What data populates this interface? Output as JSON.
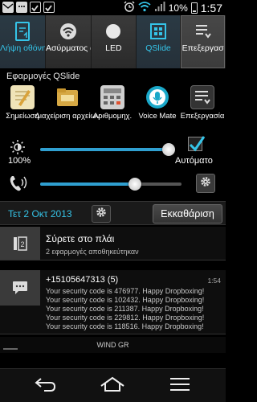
{
  "status_bar": {
    "battery_percent": "10%",
    "time": "1:57",
    "icons": [
      "email-icon",
      "sms-icon",
      "checkbox-icon",
      "checkbox-icon",
      "alarm-icon",
      "wifi-icon",
      "signal-icon",
      "battery-icon"
    ]
  },
  "quick_settings": [
    {
      "label": "Λήψη οθόνης",
      "icon": "screenshot-icon",
      "state": "on"
    },
    {
      "label": "Ασύρματος αποθηκευτ",
      "icon": "wireless-storage-icon",
      "state": "off"
    },
    {
      "label": "LED",
      "icon": "led-icon",
      "state": "off"
    },
    {
      "label": "QSlide",
      "icon": "qslide-icon",
      "state": "on"
    },
    {
      "label": "Επεξεργασ",
      "icon": "edit-icon",
      "state": "selected"
    }
  ],
  "qslide": {
    "title": "Εφαρμογές QSlide",
    "apps": [
      {
        "label": "Σημείωση",
        "icon": "memo-icon"
      },
      {
        "label": "Διαχείριση αρχείων",
        "icon": "file-manager-icon"
      },
      {
        "label": "Αριθμομηχ.",
        "icon": "calculator-icon"
      },
      {
        "label": "Voice Mate",
        "icon": "voice-mate-icon"
      },
      {
        "label": "Επεξεργασία",
        "icon": "edit-icon"
      }
    ]
  },
  "brightness": {
    "percent_label": "100%",
    "level": 1.0,
    "auto_label": "Αυτόματο",
    "auto_checked": true
  },
  "volume": {
    "level": 0.67
  },
  "date_row": {
    "date": "Τετ 2 Οκτ 2013",
    "clear_label": "Εκκαθάριση"
  },
  "notifications": [
    {
      "icon": "qslide-window-icon",
      "title": "Σύρετε στο πλάι",
      "subtitle": "2 εφαρμογές αποθηκεύτηκαν"
    },
    {
      "icon": "message-icon",
      "title": "+15105647313  (5)",
      "time": "1:54",
      "lines": [
        "Your security code is 476977. Happy Dropboxing!",
        "Your security code is 102432. Happy Dropboxing!",
        "Your security code is 211387. Happy Dropboxing!",
        "Your security code is 229812. Happy Dropboxing!",
        "Your security code is 118516. Happy Dropboxing!"
      ]
    }
  ],
  "carrier": "WIND GR",
  "colors": {
    "accent": "#35c4e8",
    "slider_fill": "#2f9fd0",
    "checkmark": "#35c4e8"
  }
}
